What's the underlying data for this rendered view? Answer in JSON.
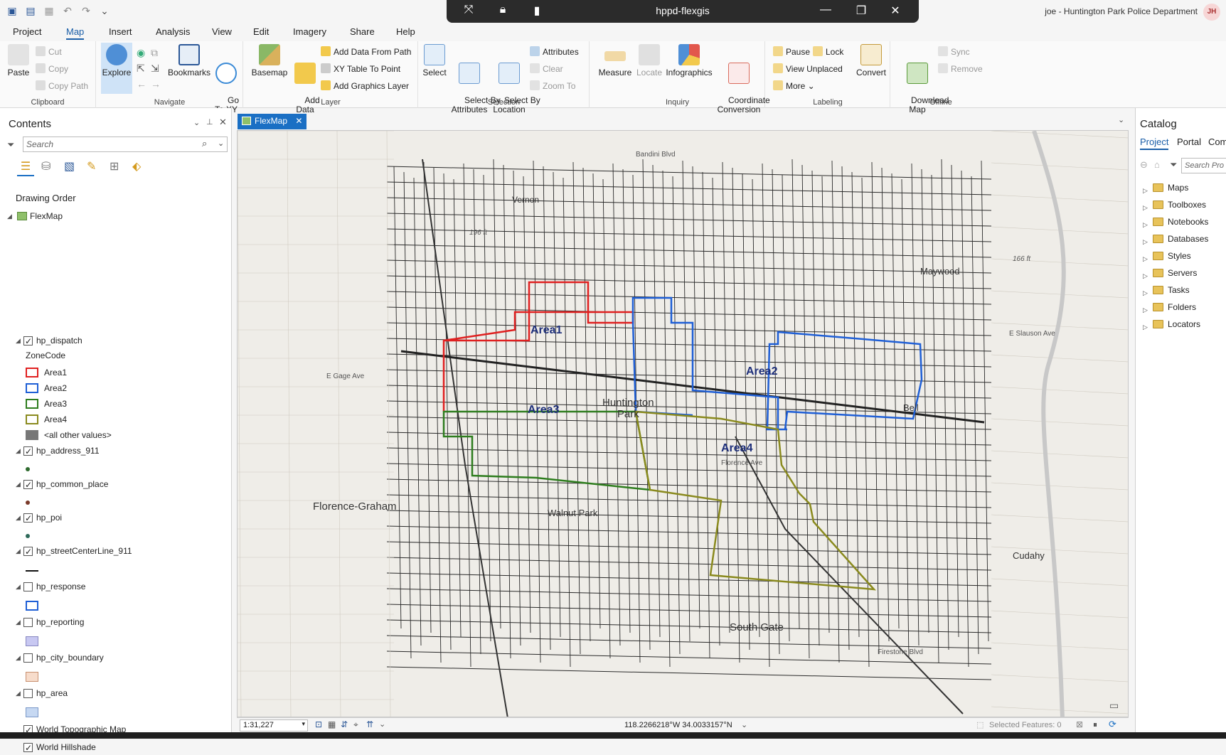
{
  "window": {
    "session_title": "hppd-flexgis",
    "user": "joe - Huntington Park Police Department",
    "avatar_initials": "JH"
  },
  "menu_tabs": [
    "Project",
    "Map",
    "Insert",
    "Analysis",
    "View",
    "Edit",
    "Imagery",
    "Share",
    "Help"
  ],
  "active_tab": "Map",
  "ribbon": {
    "clipboard": {
      "label": "Clipboard",
      "paste": "Paste",
      "cut": "Cut",
      "copy": "Copy",
      "copy_path": "Copy Path"
    },
    "navigate": {
      "label": "Navigate",
      "explore": "Explore",
      "bookmarks": "Bookmarks",
      "go_to_xy": "Go\nTo XY"
    },
    "layer": {
      "label": "Layer",
      "basemap": "Basemap",
      "add_data": "Add\nData",
      "add_data_from_path": "Add Data From Path",
      "xy_table": "XY Table To Point",
      "add_graphics": "Add Graphics Layer"
    },
    "selection": {
      "label": "Selection",
      "select": "Select",
      "select_by_attributes": "Select By\nAttributes",
      "select_by_location": "Select By\nLocation",
      "attributes": "Attributes",
      "clear": "Clear",
      "zoom_to": "Zoom To"
    },
    "inquiry": {
      "label": "Inquiry",
      "measure": "Measure",
      "locate": "Locate",
      "infographics": "Infographics",
      "coordinate_conversion": "Coordinate\nConversion"
    },
    "labeling": {
      "label": "Labeling",
      "pause": "Pause",
      "lock": "Lock",
      "view_unplaced": "View Unplaced",
      "more": "More",
      "convert": "Convert"
    },
    "offline": {
      "label": "Offline",
      "download_map": "Download\nMap",
      "sync": "Sync",
      "remove": "Remove"
    }
  },
  "contents": {
    "title": "Contents",
    "search_placeholder": "Search",
    "drawing_order": "Drawing Order",
    "map_name": "FlexMap",
    "layers": [
      {
        "name": "hp_dispatch",
        "checked": true
      },
      {
        "name": "hp_address_911",
        "checked": true
      },
      {
        "name": "hp_common_place",
        "checked": true
      },
      {
        "name": "hp_poi",
        "checked": true
      },
      {
        "name": "hp_streetCenterLine_911",
        "checked": true
      },
      {
        "name": "hp_response",
        "checked": false
      },
      {
        "name": "hp_reporting",
        "checked": false
      },
      {
        "name": "hp_city_boundary",
        "checked": false
      },
      {
        "name": "hp_area",
        "checked": false
      },
      {
        "name": "World Topographic Map",
        "checked": true
      },
      {
        "name": "World Hillshade",
        "checked": true
      }
    ],
    "zone_field": "ZoneCode",
    "zones": [
      {
        "name": "Area1",
        "color": "#e02020"
      },
      {
        "name": "Area2",
        "color": "#1f5fd6"
      },
      {
        "name": "Area3",
        "color": "#2e7d1e"
      },
      {
        "name": "Area4",
        "color": "#8a8a1e"
      },
      {
        "name": "<all other values>",
        "color": "#777777"
      }
    ]
  },
  "map_tab": "FlexMap",
  "map_labels": {
    "huntington_park": "Huntington\nPark",
    "florence_graham": "Florence-Graham",
    "walnut_park": "Walnut Park",
    "south_gate": "South Gate",
    "cudahy": "Cudahy",
    "maywood": "Maywood",
    "bell": "Bell",
    "vernon": "Vernon",
    "area1": "Area1",
    "area2": "Area2",
    "area3": "Area3",
    "area4": "Area4",
    "bandini": "Bandini Blvd",
    "slauson": "E Slauson Ave",
    "firestone": "Firestone Blvd",
    "gage": "E Gage Ave",
    "florence": "Florence Ave",
    "elev1": "196 ft",
    "elev2": "166 ft"
  },
  "status": {
    "scale": "1:31,227",
    "coordinates": "118.2266218°W 34.0033157°N",
    "selected_features": "Selected Features: 0"
  },
  "catalog": {
    "title": "Catalog",
    "tabs": [
      "Project",
      "Portal",
      "Com"
    ],
    "search_placeholder": "Search Pro",
    "items": [
      "Maps",
      "Toolboxes",
      "Notebooks",
      "Databases",
      "Styles",
      "Servers",
      "Tasks",
      "Folders",
      "Locators"
    ]
  }
}
